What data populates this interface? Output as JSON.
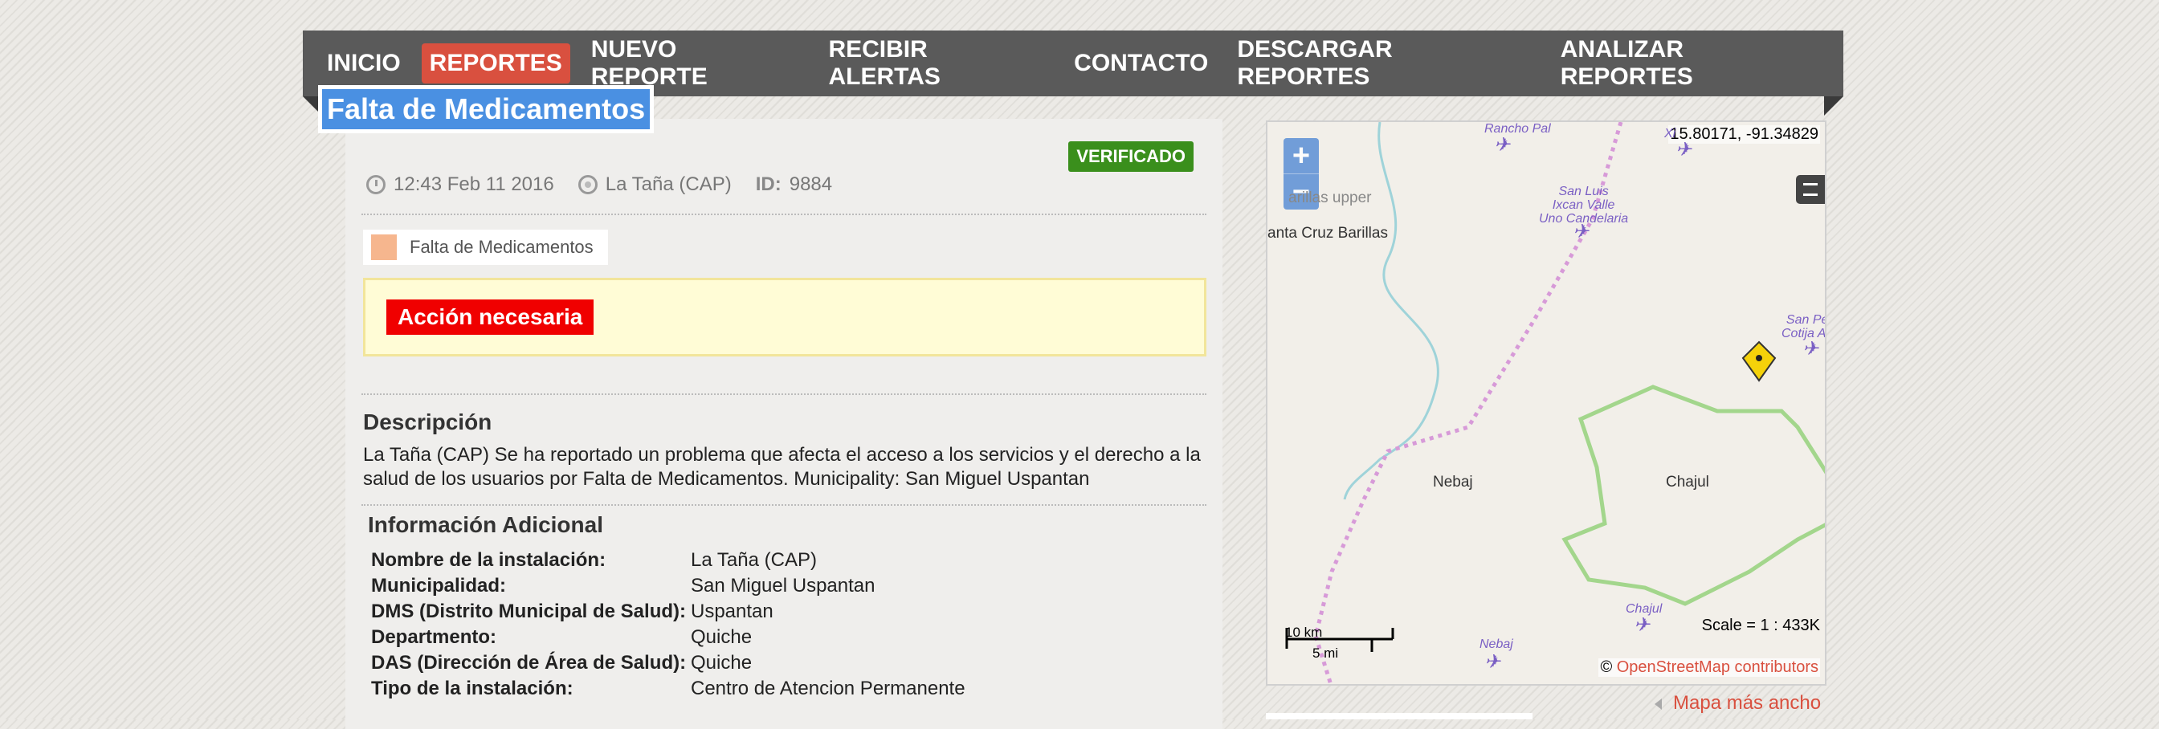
{
  "nav": {
    "items": [
      "INICIO",
      "REPORTES",
      "NUEVO REPORTE",
      "RECIBIR ALERTAS",
      "CONTACTO",
      "DESCARGAR REPORTES",
      "ANALIZAR REPORTES"
    ],
    "active": "REPORTES"
  },
  "report": {
    "title": "Falta de Medicamentos",
    "status": "VERIFICADO",
    "time": "12:43 Feb 11 2016",
    "location": "La Taña (CAP)",
    "id_label": "ID:",
    "id_value": "9884",
    "category": "Falta de Medicamentos",
    "category_color": "#f6b68e",
    "alert": "Acción necesaria",
    "description_heading": "Descripción",
    "description": "La Taña (CAP) Se ha reportado un problema que afecta el acceso a los servicios y el derecho a la salud de los usuarios por Falta de Medicamentos. Municipality: San Miguel Uspantan",
    "info_heading": "Información Adicional",
    "info": [
      {
        "label": "Nombre de la instalación:",
        "value": "La Taña (CAP)"
      },
      {
        "label": "Municipalidad:",
        "value": "San Miguel Uspantan"
      },
      {
        "label": "DMS (Distrito Municipal de Salud):",
        "value": "Uspantan"
      },
      {
        "label": "Departmento:",
        "value": "Quiche"
      },
      {
        "label": "DAS (Dirección de Área de Salud):",
        "value": "Quiche"
      },
      {
        "label": "Tipo de la instalación:",
        "value": "Centro de Atencion Permanente"
      }
    ]
  },
  "map": {
    "coords": "15.80171, -91.34829",
    "zoom_in": "+",
    "zoom_out": "−",
    "places": {
      "santa_cruz": "anta Cruz Barillas",
      "barillas_upper": "arillas upper",
      "nebaj": "Nebaj",
      "chajul": "Chajul"
    },
    "airports": {
      "rancho_pal": "Rancho Pal",
      "san_luis": "San Luis\nIxcan Valle\nUno Candelaria",
      "xi": "Xi",
      "san_pe": "San Pe\nCotija Air",
      "chajul_air": "Chajul",
      "nebaj_air": "Nebaj"
    },
    "scale_km": "10 km",
    "scale_mi": "5 mi",
    "scale": "Scale = 1 : 433K",
    "attribution_prefix": "©",
    "attribution_link": "OpenStreetMap contributors",
    "wider_link": "Mapa más ancho",
    "colors": {
      "marker": "#f5d20a",
      "border": "#8fcf74",
      "path": "#d79ad8",
      "river": "#9fd3d9",
      "airport": "#7a5fc4"
    }
  }
}
